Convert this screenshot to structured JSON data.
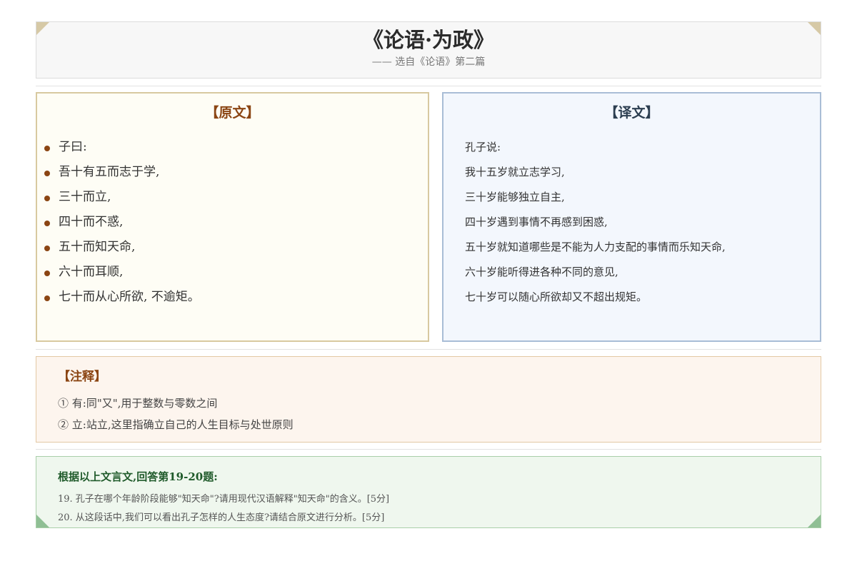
{
  "header": {
    "title": "《论语·为政》",
    "subtitle": "—— 选自《论语》第二篇"
  },
  "original": {
    "heading": "【原文】",
    "lines": [
      "子曰:",
      "吾十有五而志于学,",
      "三十而立,",
      "四十而不惑,",
      "五十而知天命,",
      "六十而耳顺,",
      "七十而从心所欲,  不逾矩。"
    ]
  },
  "translation": {
    "heading": "【译文】",
    "lines": [
      "孔子说:",
      "我十五岁就立志学习,",
      "三十岁能够独立自主,",
      "四十岁遇到事情不再感到困惑,",
      "五十岁就知道哪些是不能为人力支配的事情而乐知天命,",
      "六十岁能听得进各种不同的意见,",
      "七十岁可以随心所欲却又不超出规矩。"
    ]
  },
  "notes": {
    "heading": "【注释】",
    "items": [
      "① 有:同\"又\",用于整数与零数之间",
      "② 立:站立,这里指确立自己的人生目标与处世原则"
    ]
  },
  "questions": {
    "heading": "根据以上文言文,回答第19-20题:",
    "items": [
      "19. 孔子在哪个年龄阶段能够\"知天命\"?请用现代汉语解释\"知天命\"的含义。[5分]",
      "20. 从这段话中,我们可以看出孔子怎样的人生态度?请结合原文进行分析。[5分]"
    ]
  },
  "colors": {
    "original_accent": "#8b4513",
    "translation_accent": "#2c3e50",
    "questions_accent": "#1f5a2a",
    "corner_top": "#d6c9a6",
    "corner_bottom": "#8fbf94"
  }
}
